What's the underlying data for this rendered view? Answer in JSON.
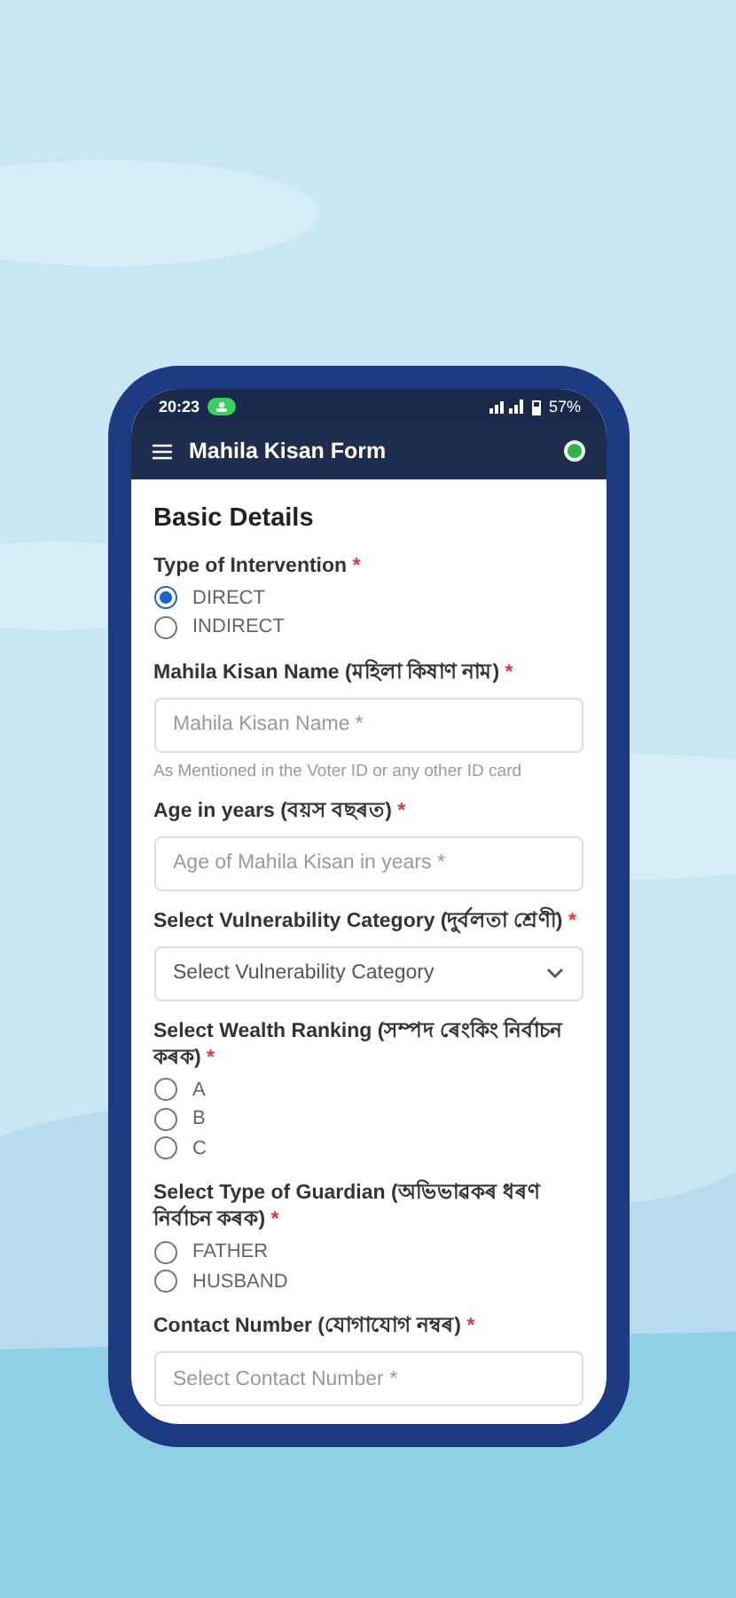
{
  "status_bar": {
    "time": "20:23",
    "battery": "57%"
  },
  "app_bar": {
    "title": "Mahila Kisan Form"
  },
  "section": {
    "title": "Basic Details"
  },
  "fields": [
    {
      "kind": "radio",
      "label": "Type of Intervention",
      "mark": "*",
      "options": [
        {
          "label": "DIRECT",
          "selected": true
        },
        {
          "label": "INDIRECT",
          "selected": false
        }
      ]
    },
    {
      "kind": "text",
      "label": "Mahila Kisan Name (মহিলা কিষাণ নাম)",
      "mark": "*",
      "placeholder": "Mahila Kisan Name *",
      "helper": "As Mentioned in the Voter ID or any other ID card"
    },
    {
      "kind": "text",
      "label": "Age in years (বয়স বছৰত)",
      "mark": "*",
      "placeholder": "Age of Mahila Kisan in years *"
    },
    {
      "kind": "select",
      "label": "Select Vulnerability Category (দুৰ্বলতা শ্ৰেণী)",
      "mark": "*",
      "placeholder": "Select Vulnerability Category"
    },
    {
      "kind": "radio",
      "label": "Select Wealth Ranking (সম্পদ ৰেংকিং নিৰ্বাচন কৰক)",
      "mark": "*",
      "options": [
        {
          "label": "A",
          "selected": false
        },
        {
          "label": "B",
          "selected": false
        },
        {
          "label": "C",
          "selected": false
        }
      ]
    },
    {
      "kind": "radio",
      "label": "Select Type of Guardian (অভিভাৱকৰ ধৰণ নিৰ্বাচন কৰক)",
      "mark": "*",
      "options": [
        {
          "label": "FATHER",
          "selected": false
        },
        {
          "label": "HUSBAND",
          "selected": false
        }
      ]
    },
    {
      "kind": "text",
      "label": "Contact Number (যোগাযোগ নম্বৰ)",
      "mark": "*",
      "placeholder": "Select Contact Number *"
    }
  ]
}
